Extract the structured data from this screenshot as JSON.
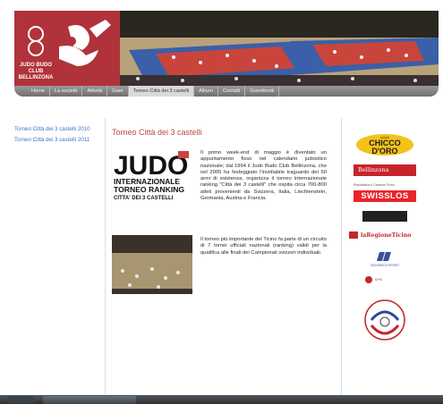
{
  "header": {
    "logo_lines": [
      "JUDO BUDO",
      "CLUB",
      "BELLINZONA"
    ]
  },
  "nav": {
    "items": [
      "Home",
      "La società",
      "Attività",
      "Gare",
      "Torneo Città dei 3 castelli",
      "Album",
      "Contatti",
      "Guestbook"
    ],
    "active_index": 4
  },
  "sidebar": {
    "links": [
      "Torneo Città dei 3 castelli 2010",
      "Torneo Città dei 3 castelli 2011"
    ]
  },
  "main": {
    "title": "Torneo Città dei 3 castelli",
    "paragraph1": "Il primo week-end di maggio è diventato un appuntamento fisso nel calendario judoistico nazionale; dal 1994 il Judo Budo Club Bellinzona, che nel 2005 ha festeggiato l'invidiabile traguardo dei 50 anni di esistenza, organizza il torneo internazionale ranking \"Città dei 3 castelli\" che ospita circa 700-800 atleti provenienti da Svizzera, Italia, Liechtenstein, Germania, Austria e Francia.",
    "paragraph2": "Il torneo più importante del Ticino fa parte di un circuito di 7 tornei ufficiali nazionali (ranking) validi per la qualifica alle finali dei Campionati svizzeri individuali.",
    "event_logo": {
      "word": "JUDO",
      "line1": "INTERNAZIONALE",
      "line2": "TORNEO RANKING",
      "line3": "CITTA' DEI 3 CASTELLI"
    }
  },
  "sponsors": {
    "chicco_small": "CAFFÈ",
    "chicco_line1": "CHICCO",
    "chicco_line2": "D'ORO",
    "bellinzona": "Bellinzona",
    "repubblica": "Repubblica e Cantone Ticino",
    "swisslos": "SWISSLOS",
    "regione": "laRegioneTicino",
    "gioventu": "GIOVENTÙ+SPORT",
    "csi": "G+S"
  },
  "colors": {
    "brand_red": "#b0323a",
    "title_red": "#c04a3a",
    "link_blue": "#3a78c8"
  }
}
